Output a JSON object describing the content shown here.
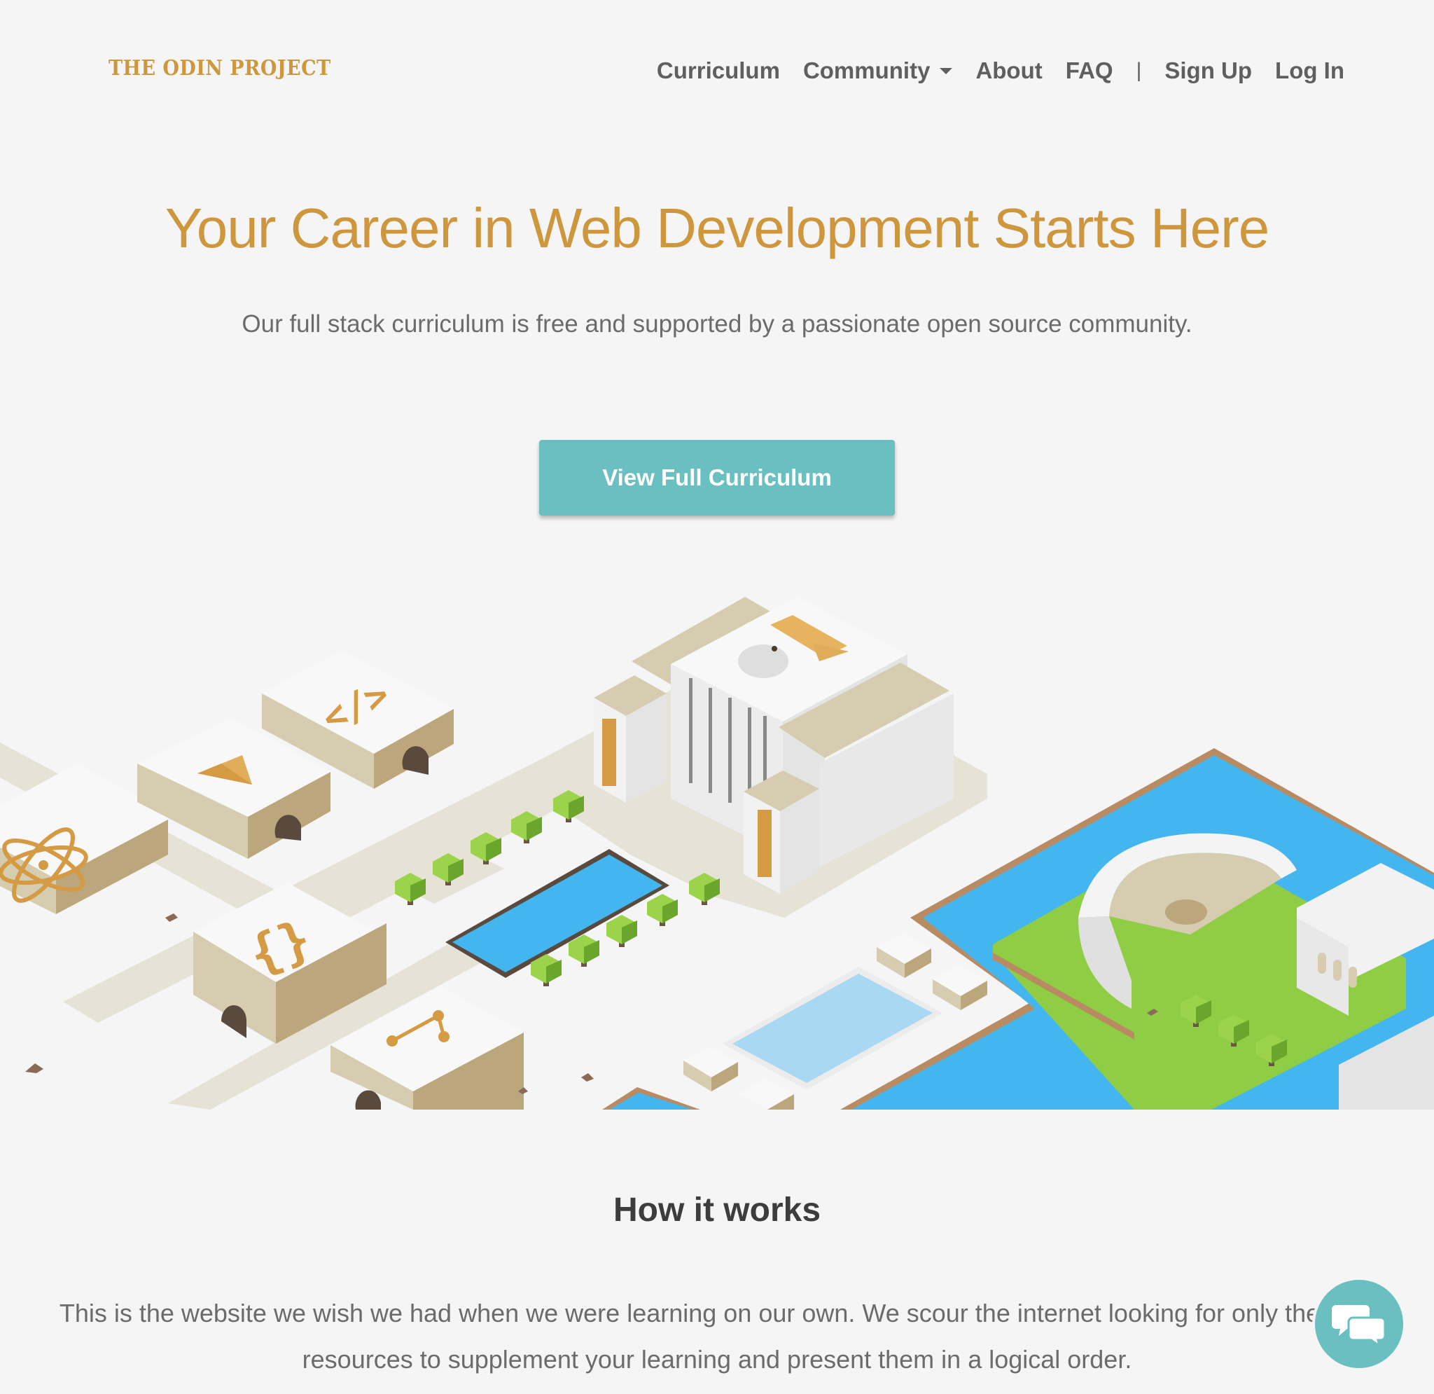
{
  "brand": {
    "name": "THE ODIN PROJECT"
  },
  "nav": {
    "items": [
      {
        "label": "Curriculum"
      },
      {
        "label": "Community"
      },
      {
        "label": "About"
      },
      {
        "label": "FAQ"
      }
    ],
    "separator": "|",
    "sign_up": "Sign Up",
    "log_in": "Log In"
  },
  "hero": {
    "title": "Your Career in Web Development Starts Here",
    "subtitle": "Our full stack curriculum is free and supported by a passionate open source community.",
    "cta_label": "View Full Curriculum"
  },
  "how_it_works": {
    "title": "How it works",
    "body": "This is the website we wish we had when we were learning on our own. We scour the internet looking for only the best resources to supplement your learning and present them in a logical order."
  },
  "icons": {
    "logo": "odin-helmet-logo",
    "dropdown": "caret-down-icon",
    "chat": "chat-bubbles-icon"
  },
  "colors": {
    "brand_gold": "#ce973e",
    "accent_teal": "#6abfc1",
    "background": "#f5f5f5",
    "nav_text": "#5f5f5f",
    "water_blue": "#44b6ef",
    "grass_green": "#8fcd45"
  }
}
